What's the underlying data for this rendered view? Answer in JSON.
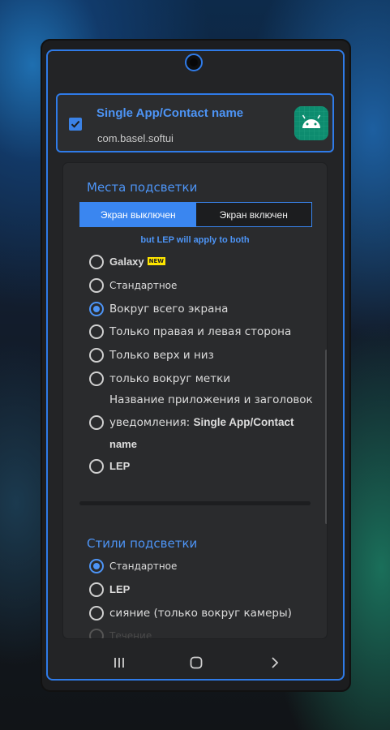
{
  "app_card": {
    "checked": true,
    "title": "Single App/Contact name",
    "package": "com.basel.softui",
    "icon": "android-robot-icon"
  },
  "locations": {
    "title": "Места подсветки",
    "tabs": [
      {
        "label": "Экран выключен",
        "active": true
      },
      {
        "label": "Экран включен",
        "active": false
      }
    ],
    "note": "but LEP will apply to both",
    "options": [
      {
        "label": "Galaxy",
        "badge": "NEW",
        "selected": false
      },
      {
        "label": "Стандартное",
        "selected": false
      },
      {
        "label": "Вокруг всего экрана",
        "selected": true
      },
      {
        "label": "Только правая и левая сторона",
        "selected": false
      },
      {
        "label": "Только верх и низ",
        "selected": false
      },
      {
        "label": "только вокруг метки",
        "selected": false
      }
    ],
    "subheading": "Название приложения и заголовок",
    "notif_option": {
      "prefix": "уведомления: ",
      "bold": "Single App/Contact",
      "line2": "name"
    },
    "lep_option": "LEP"
  },
  "styles": {
    "title": "Стили подсветки",
    "options": [
      {
        "label": "Стандартное",
        "selected": true
      },
      {
        "label": "LEP",
        "selected": false
      },
      {
        "label": "сияние (только вокруг камеры)",
        "selected": false
      },
      {
        "label": "Течение",
        "selected": false
      }
    ]
  },
  "navbar": {
    "icons": [
      "recents-icon",
      "home-icon",
      "back-icon"
    ]
  },
  "colors": {
    "accent": "#4d94f5",
    "border": "#2f7be8",
    "badge": "#ffe600"
  }
}
